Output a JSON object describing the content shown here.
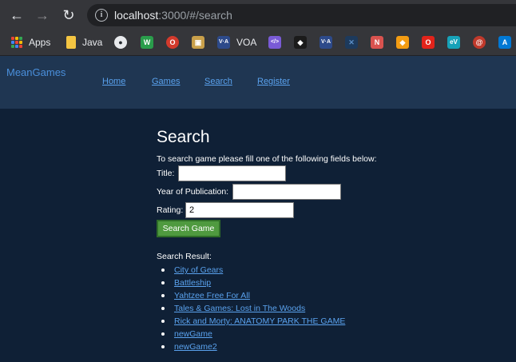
{
  "browser": {
    "url_host": "localhost",
    "url_rest": ":3000/#/search",
    "bookmarks": [
      {
        "icon": "apps-grid-icon",
        "label": "Apps"
      },
      {
        "icon": "folder-icon",
        "label": "Java"
      },
      {
        "icon": "github-icon",
        "label": ""
      },
      {
        "icon": "bookmark-w-icon",
        "label": "",
        "glyph": "W",
        "color": "#2a9d4b"
      },
      {
        "icon": "bookmark-o-icon",
        "label": "",
        "glyph": "O",
        "color": "#d33a2c"
      },
      {
        "icon": "box-icon",
        "label": "",
        "glyph": "▣",
        "color": "#c9a04a"
      },
      {
        "icon": "voa-icon",
        "label": "VOA",
        "glyph": "V·A",
        "color": "#2d4a8a"
      },
      {
        "icon": "code-icon",
        "label": "",
        "glyph": "</>",
        "color": "#7a5bd6"
      },
      {
        "icon": "bird-icon",
        "label": "",
        "glyph": "◆",
        "color": "#222"
      },
      {
        "icon": "voa-icon-2",
        "label": "",
        "glyph": "V·A",
        "color": "#2d4a8a"
      },
      {
        "icon": "x-icon",
        "label": "",
        "glyph": "✕",
        "color": "#3a6fa8"
      },
      {
        "icon": "nav-icon",
        "label": "",
        "glyph": "N",
        "color": "#d9534f"
      },
      {
        "icon": "slack-icon",
        "label": "",
        "glyph": "#",
        "color": "#3aa0d8"
      },
      {
        "icon": "cube-icon",
        "label": "",
        "glyph": "◆",
        "color": "#f39c12"
      },
      {
        "icon": "oracle-icon",
        "label": "",
        "glyph": "O",
        "color": "#e2231a"
      },
      {
        "icon": "ev-icon",
        "label": "",
        "glyph": "eV",
        "color": "#17a2b8"
      },
      {
        "icon": "swirl-icon",
        "label": "",
        "glyph": "@",
        "color": "#c0392b"
      },
      {
        "icon": "azure-icon",
        "label": "",
        "glyph": "A",
        "color": "#0078d4"
      }
    ]
  },
  "header": {
    "brand": "MeanGames",
    "nav": [
      "Home",
      "Games",
      "Search",
      "Register"
    ]
  },
  "search": {
    "title": "Search",
    "intro": "To search game please fill one of the following fields below:",
    "title_label": "Title:",
    "title_value": "",
    "year_label": "Year of Publication:",
    "year_value": "",
    "rating_label": "Rating:",
    "rating_value": "2",
    "button_label": "Search Game",
    "result_label": "Search Result:",
    "results": [
      "City of Gears",
      "Battleship",
      "Yahtzee Free For All",
      "Tales & Games: Lost in The Woods",
      "Rick and Morty: ANATOMY PARK THE GAME",
      "newGame",
      "newGame2"
    ]
  },
  "colors": {
    "page_bg": "#0f2036",
    "header_bg": "#1f3652",
    "link": "#5aa2ee",
    "button_bg": "#4f9a3f"
  }
}
